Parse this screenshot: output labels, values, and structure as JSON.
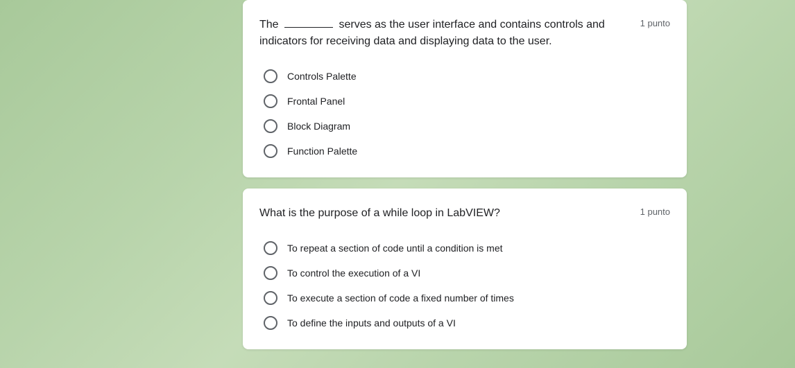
{
  "questions": [
    {
      "prompt_before": "The ",
      "prompt_after": " serves as the user interface and contains controls and indicators for receiving data and displaying data to the user.",
      "points": "1 punto",
      "has_blank": true,
      "options": [
        "Controls Palette",
        "Frontal Panel",
        "Block Diagram",
        "Function Palette"
      ]
    },
    {
      "prompt_before": "What is the purpose of a while loop in LabVIEW?",
      "prompt_after": "",
      "points": "1 punto",
      "has_blank": false,
      "options": [
        "To repeat a section of code until a condition is met",
        "To control the execution of a VI",
        "To execute a section of code a fixed number of times",
        "To define the inputs and outputs of a VI"
      ]
    }
  ]
}
